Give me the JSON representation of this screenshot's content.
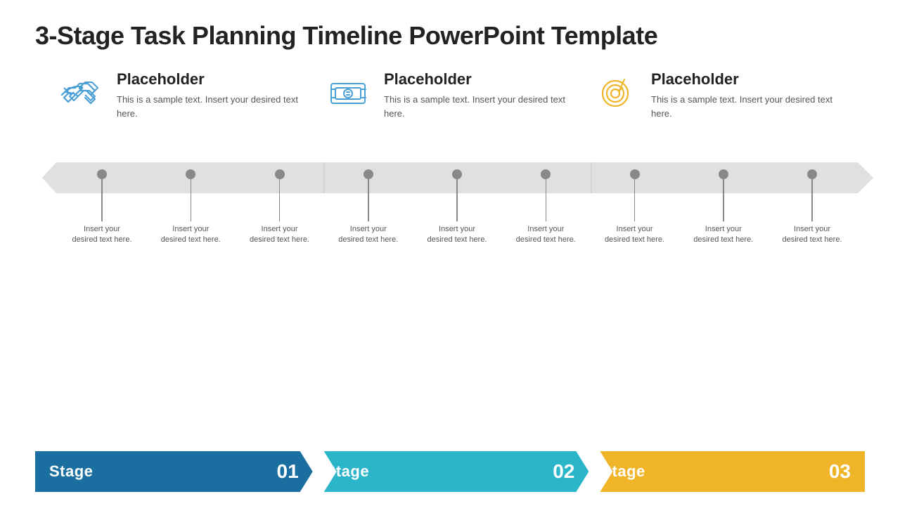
{
  "title": "3-Stage Task Planning Timeline PowerPoint Template",
  "stages": [
    {
      "id": 1,
      "icon": "handshake",
      "icon_color": "#4a9fd4",
      "placeholder_title": "Placeholder",
      "placeholder_text": "This is a sample text. Insert your desired text here."
    },
    {
      "id": 2,
      "icon": "money",
      "icon_color": "#4a9fd4",
      "placeholder_title": "Placeholder",
      "placeholder_text": "This is a sample text. Insert your desired text here."
    },
    {
      "id": 3,
      "icon": "target",
      "icon_color": "#f0b429",
      "placeholder_title": "Placeholder",
      "placeholder_text": "This is a sample text. Insert your desired text here."
    }
  ],
  "timeline_dots": [
    {
      "label": "Insert your desired text here."
    },
    {
      "label": "Insert your desired text here."
    },
    {
      "label": "Insert your desired text here."
    },
    {
      "label": "Insert your desired text here."
    },
    {
      "label": "Insert your desired text here."
    },
    {
      "label": "Insert your desired text here."
    },
    {
      "label": "Insert your desired text here."
    },
    {
      "label": "Insert your desired text here."
    },
    {
      "label": "Insert your desired text here."
    }
  ],
  "stage_bars": [
    {
      "label": "Stage",
      "number": "01",
      "color": "#1a6fa0"
    },
    {
      "label": "Stage",
      "number": "02",
      "color": "#2ab5c8"
    },
    {
      "label": "Stage",
      "number": "03",
      "color": "#f0b429"
    }
  ]
}
